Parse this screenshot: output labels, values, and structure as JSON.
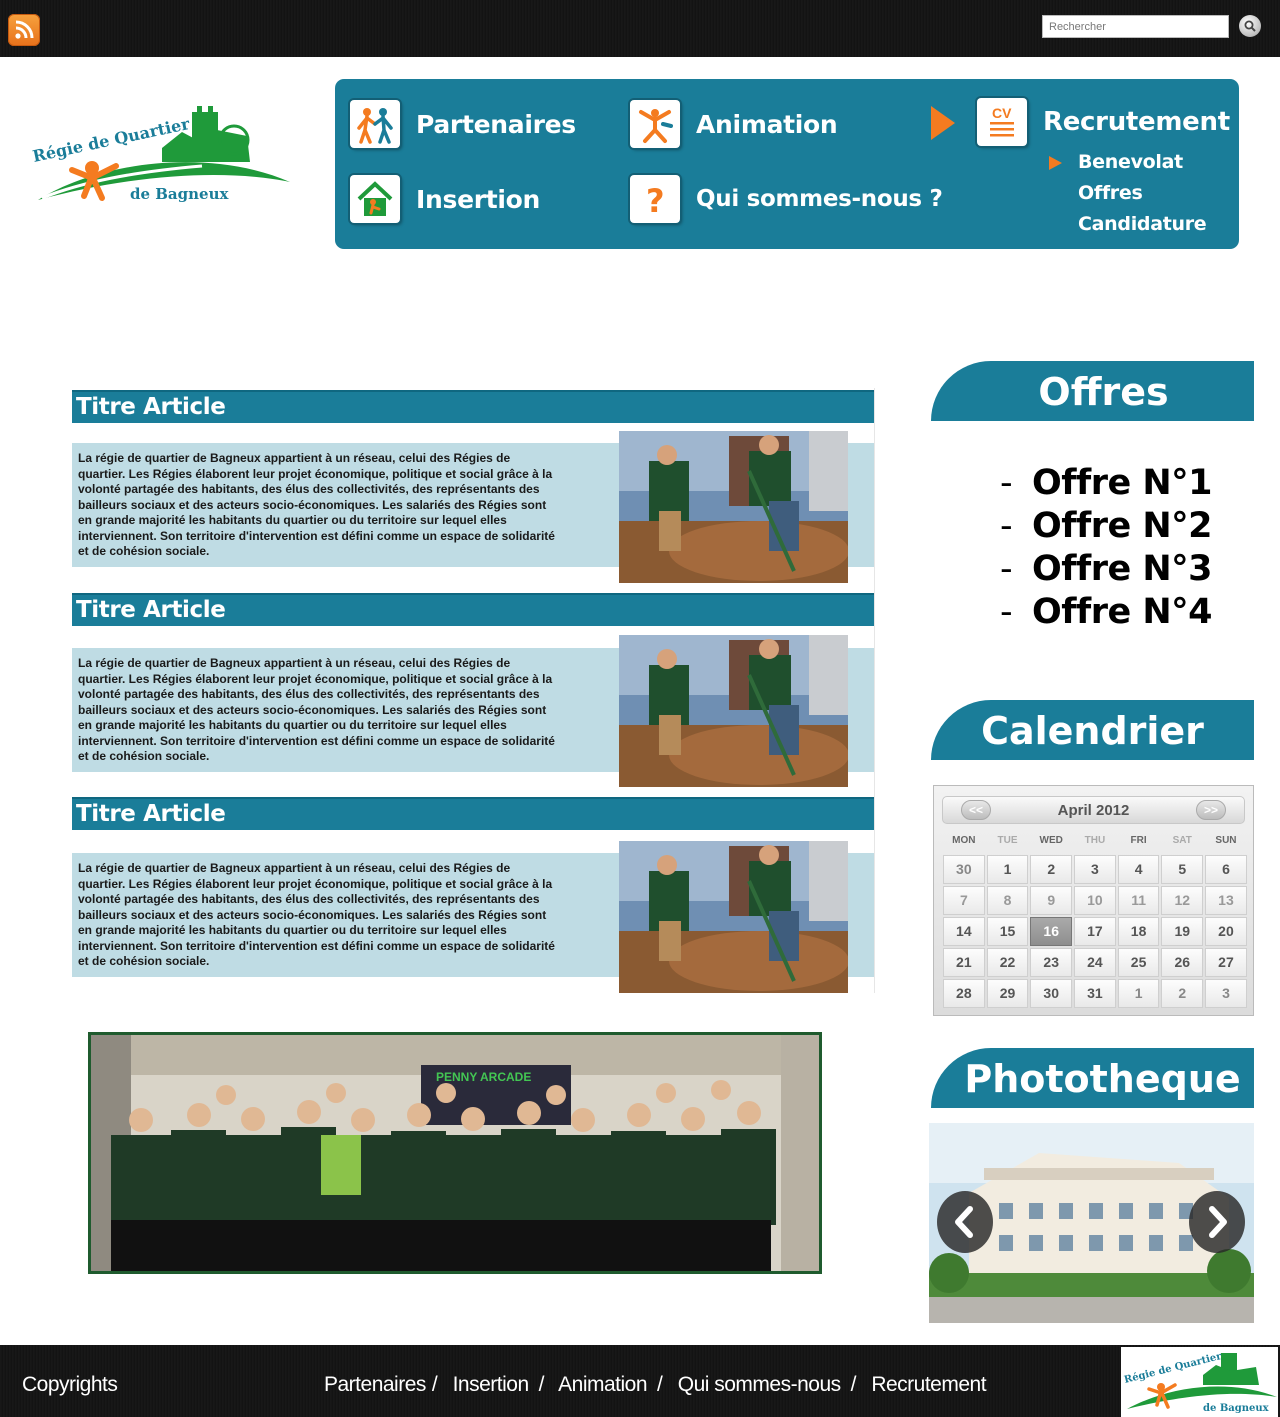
{
  "topbar": {
    "rss_icon": "rss-feed-icon",
    "search_placeholder": "Rechercher",
    "search_icon": "magnifier-icon"
  },
  "logo": {
    "line1": "Régie de Quartier",
    "line2": "de Bagneux"
  },
  "nav": {
    "items": [
      {
        "label": "Partenaires",
        "icon": "partners-icon"
      },
      {
        "label": "Animation",
        "icon": "animation-icon"
      },
      {
        "label": "Recrutement",
        "icon": "cv-icon"
      },
      {
        "label": "Insertion",
        "icon": "house-icon"
      },
      {
        "label": "Qui sommes-nous ?",
        "icon": "question-icon"
      }
    ],
    "submenu": [
      "Benevolat",
      "Offres",
      "Candidature"
    ],
    "colors": {
      "panel": "#1a7d99",
      "accent": "#f47b20"
    }
  },
  "articles": [
    {
      "title": "Titre Article",
      "text": "La régie de quartier de Bagneux appartient à un réseau, celui des Régies de quartier. Les Régies élaborent leur projet économique, politique et social grâce à la volonté partagée des habitants, des élus des collectivités, des représentants des bailleurs sociaux et des acteurs socio-économiques. Les salariés des Régies sont en grande majorité les habitants du quartier ou du territoire sur lequel elles interviennent. Son territoire d'intervention est défini comme un espace de solidarité et de cohésion sociale."
    },
    {
      "title": "Titre Article",
      "text": "La régie de quartier de Bagneux appartient à un réseau, celui des Régies de quartier. Les Régies élaborent leur projet économique, politique et social grâce à la volonté partagée des habitants, des élus des collectivités, des représentants des bailleurs sociaux et des acteurs socio-économiques. Les salariés des Régies sont en grande majorité les habitants du quartier ou du territoire sur lequel elles interviennent. Son territoire d'intervention est défini comme un espace de solidarité et de cohésion sociale."
    },
    {
      "title": "Titre Article",
      "text": "La régie de quartier de Bagneux appartient à un réseau, celui des Régies de quartier. Les Régies élaborent leur projet économique, politique et social grâce à la volonté partagée des habitants, des élus des collectivités, des représentants des bailleurs sociaux et des acteurs socio-économiques. Les salariés des Régies sont en grande majorité les habitants du quartier ou du territoire sur lequel elles interviennent. Son territoire d'intervention est défini comme un espace de solidarité et de cohésion sociale."
    }
  ],
  "group_photo": {
    "sign": "PENNY ARCADE"
  },
  "sidebar": {
    "offers_title": "Offres",
    "offers": [
      "Offre N°1",
      "Offre N°2",
      "Offre N°3",
      "Offre N°4"
    ],
    "offer_dash": "-",
    "calendar_title": "Calendrier",
    "calendar": {
      "month": "April 2012",
      "prev": "<<",
      "next": ">>",
      "days_of_week": [
        "MON",
        "TUE",
        "WED",
        "THU",
        "FRI",
        "SAT",
        "SUN"
      ],
      "weeks": [
        [
          "30",
          "1",
          "2",
          "3",
          "4",
          "5",
          "6"
        ],
        [
          "7",
          "8",
          "9",
          "10",
          "11",
          "12",
          "13"
        ],
        [
          "14",
          "15",
          "16",
          "17",
          "18",
          "19",
          "20"
        ],
        [
          "21",
          "22",
          "23",
          "24",
          "25",
          "26",
          "27"
        ],
        [
          "28",
          "29",
          "30",
          "31",
          "1",
          "2",
          "3"
        ]
      ],
      "today": "16"
    },
    "phototheque_title": "Phototheque",
    "prev_icon": "chevron-left-icon",
    "next_icon": "chevron-right-icon"
  },
  "footer": {
    "copyright": "Copyrights",
    "links": [
      "Partenaires",
      "Insertion",
      "Animation",
      "Qui sommes-nous",
      "Recrutement"
    ],
    "separator": "/"
  }
}
